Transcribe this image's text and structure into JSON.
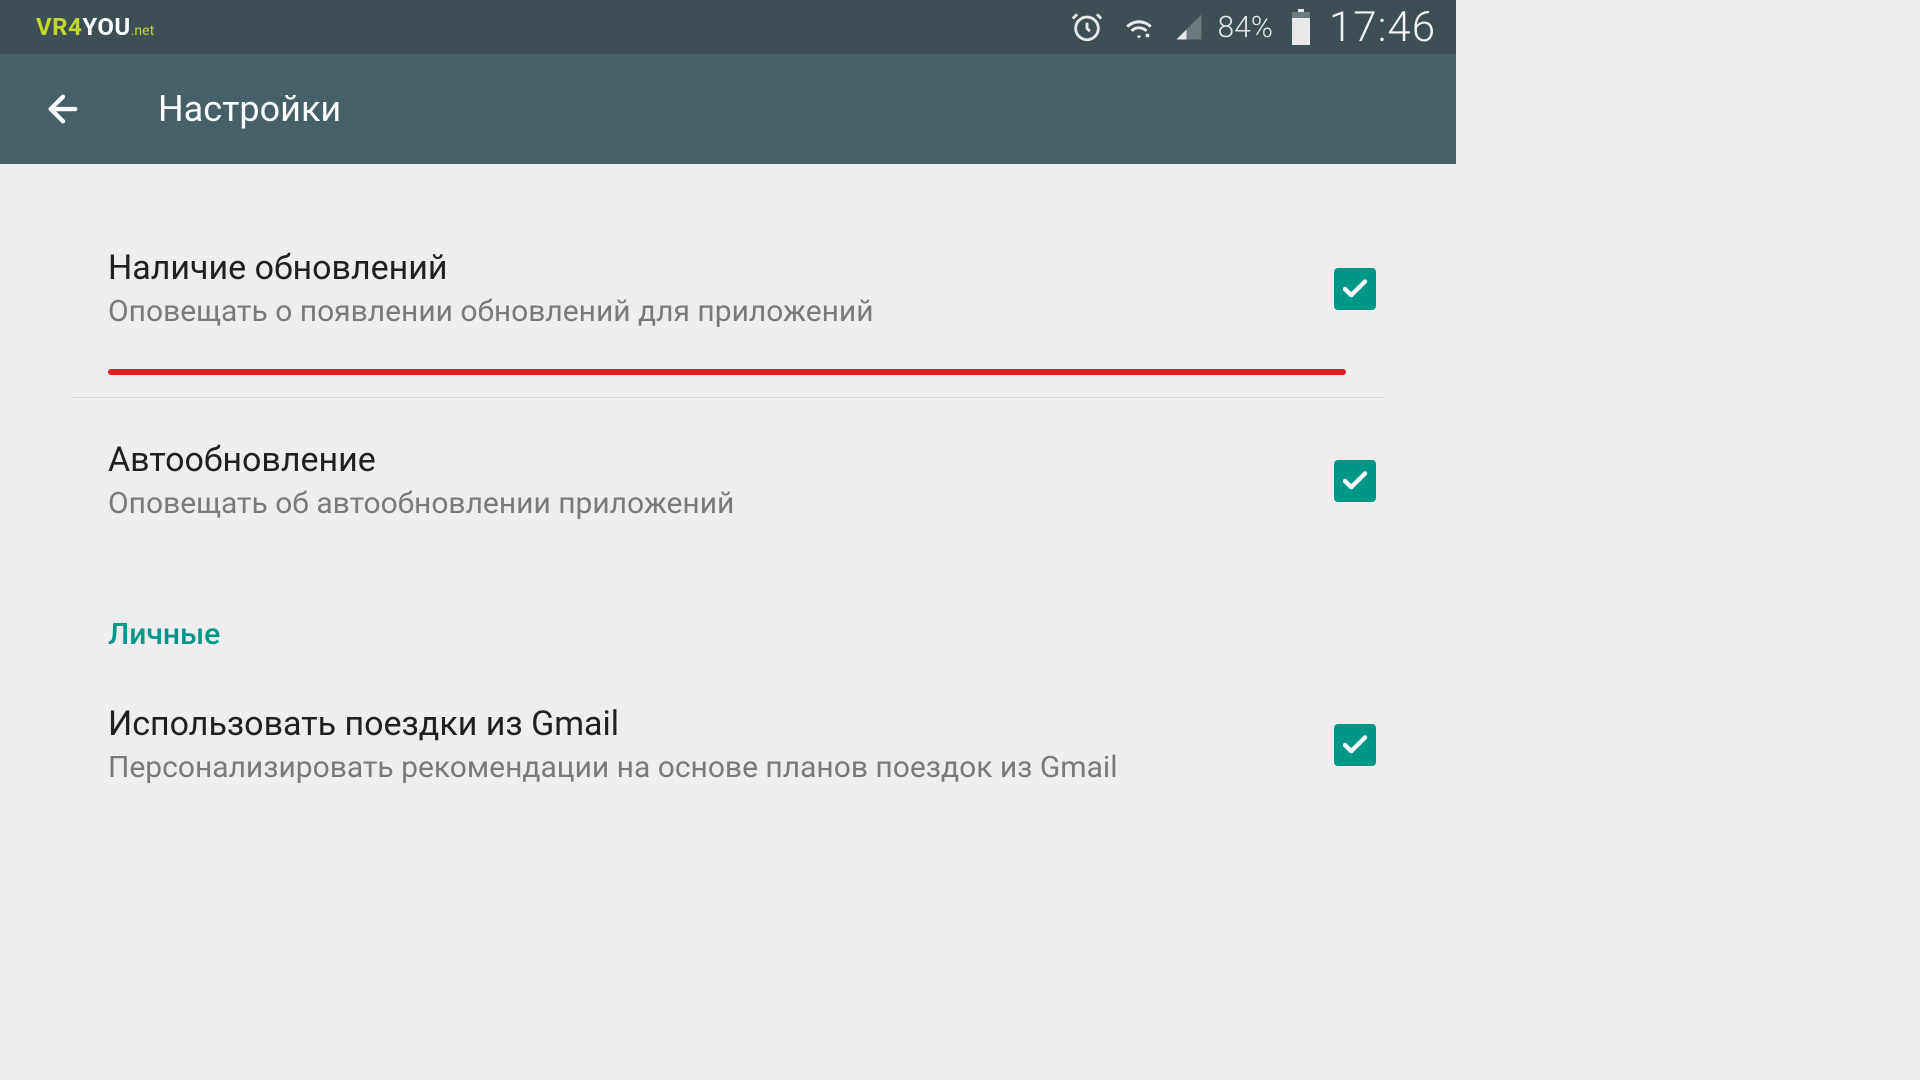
{
  "status_bar": {
    "logo_vr4": "VR4",
    "logo_you": "YOU",
    "logo_net": ".net",
    "battery_percent": "84%",
    "time": "17:46"
  },
  "app_bar": {
    "title": "Настройки"
  },
  "settings": {
    "updates_available": {
      "title": "Наличие обновлений",
      "subtitle": "Оповещать о появлении обновлений для приложений",
      "checked": true
    },
    "auto_update": {
      "title": "Автообновление",
      "subtitle": "Оповещать об автообновлении приложений",
      "checked": true
    }
  },
  "section_personal": "Личные",
  "gmail_trips": {
    "title": "Использовать поездки из Gmail",
    "subtitle": "Персонализировать рекомендации на основе планов поездок из Gmail",
    "checked": true
  }
}
